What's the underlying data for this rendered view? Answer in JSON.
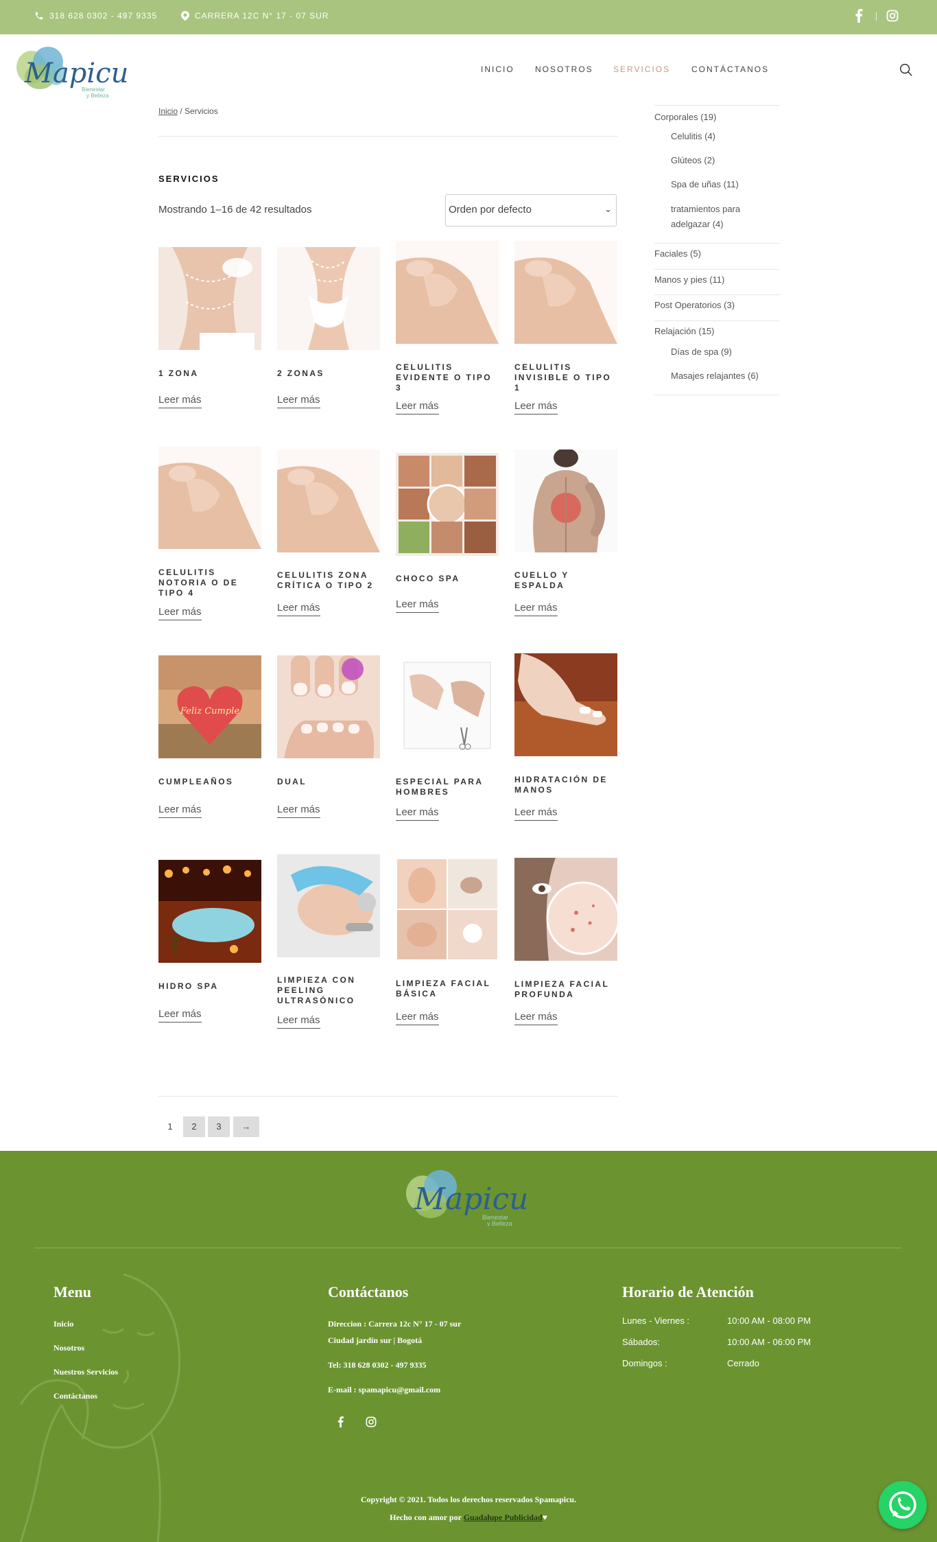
{
  "topbar": {
    "phone": "318 628 0302 - 497 9335",
    "address": "CARRERA 12C N° 17 - 07 SUR"
  },
  "brand": {
    "logo_text": "Mapicu",
    "logo_tagline_1": "Bienestar",
    "logo_tagline_2": "y Belleza"
  },
  "nav": {
    "items": [
      "INICIO",
      "NOSOTROS",
      "SERVICIOS",
      "CONTÁCTANOS"
    ],
    "active_color": "#c59a84"
  },
  "breadcrumb": {
    "home": "Inicio",
    "separator": " / ",
    "current": "Servicios"
  },
  "main": {
    "title": "SERVICIOS",
    "result_count": "Mostrando 1–16 de 42 resultados",
    "orderby": "Orden por defecto",
    "read_more": "Leer más"
  },
  "products": [
    {
      "title": "1 ZONA"
    },
    {
      "title": "2 ZONAS"
    },
    {
      "title": "CELULITIS EVIDENTE O TIPO 3"
    },
    {
      "title": "CELULITIS INVISIBLE O TIPO 1"
    },
    {
      "title": "CELULITIS NOTORIA O DE TIPO 4"
    },
    {
      "title": "CELULITIS ZONA CRÍTICA O TIPO 2"
    },
    {
      "title": "CHOCO SPA"
    },
    {
      "title": "CUELLO Y ESPALDA"
    },
    {
      "title": "CUMPLEAÑOS"
    },
    {
      "title": "DUAL"
    },
    {
      "title": "ESPECIAL PARA HOMBRES"
    },
    {
      "title": "HIDRATACIÓN DE MANOS"
    },
    {
      "title": "HIDRO SPA"
    },
    {
      "title": "LIMPIEZA CON PEELING ULTRASÓNICO"
    },
    {
      "title": "LIMPIEZA FACIAL BÁSICA"
    },
    {
      "title": "LIMPIEZA FACIAL PROFUNDA"
    }
  ],
  "sidebar": {
    "categories": [
      {
        "label": "Corporales (19)"
      },
      {
        "label": "Celulitis (4)"
      },
      {
        "label": "Glúteos (2)"
      },
      {
        "label": "Spa de uñas (11)"
      },
      {
        "label": "tratamientos para"
      },
      {
        "label": "adelgazar (4)"
      },
      {
        "label": "Faciales (5)"
      },
      {
        "label": "Manos y pies (11)"
      },
      {
        "label": "Post Operatorios (3)"
      },
      {
        "label": "Relajación (15)"
      },
      {
        "label": "Días de spa (9)"
      },
      {
        "label": "Masajes relajantes (6)"
      }
    ]
  },
  "pagination": {
    "current": "1",
    "pages": [
      "2",
      "3"
    ],
    "next": "→"
  },
  "footer": {
    "menu_title": "Menu",
    "menu_items": [
      "Inicio",
      "Nosotros",
      "Nuestros Servicios",
      "Contáctanos"
    ],
    "contact_title": "Contáctanos",
    "contact_line1": "Direccion : Carrera 12c N° 17 - 07 sur",
    "contact_line2": "Ciudad jardín sur | Bogotá",
    "contact_tel": "Tel: 318 628 0302 - 497 9335",
    "contact_email": "E-mail : spamapicu@gmail.com",
    "hours_title": "Horario de Atención",
    "hours": [
      {
        "day": "Lunes - Viernes :",
        "time": "10:00 AM - 08:00 PM"
      },
      {
        "day": "Sábados:",
        "time": "10:00 AM - 06:00 PM"
      },
      {
        "day": "Domingos :",
        "time": "Cerrado"
      }
    ],
    "copyright": "Copyright © 2021. Todos los derechos reservados Spamapicu.",
    "made_with": "Hecho con amor por ",
    "agency": "Guadalupe Publicidad",
    "heart": "♥"
  },
  "colors": {
    "topbar_bg": "#a9c47f",
    "footer_bg": "#6b9431",
    "whatsapp": "#25d366"
  }
}
